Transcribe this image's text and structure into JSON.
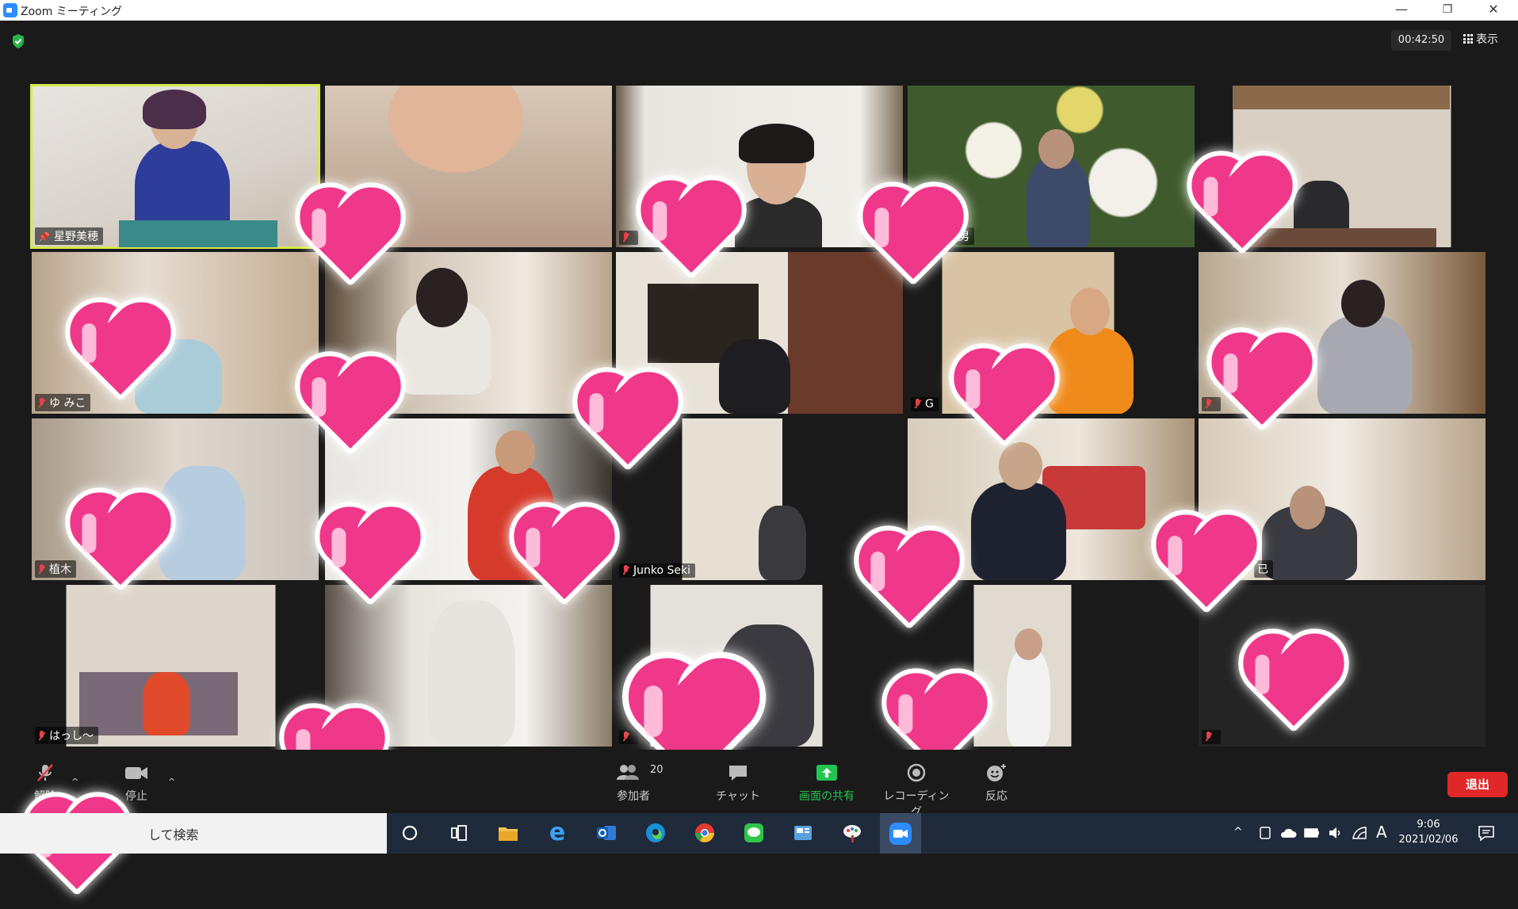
{
  "window": {
    "title": "Zoom ミーティング",
    "minimize": "—",
    "restore": "❐",
    "close": "✕"
  },
  "meeting": {
    "timer": "00:42:50",
    "view_label": "表示",
    "security_color": "#2bb24c",
    "active_border_color": "#d6e94b"
  },
  "participants": [
    {
      "name": "星野美穂",
      "muted": false,
      "pinned": true
    },
    {
      "name": "",
      "muted": false
    },
    {
      "name": "",
      "muted": true
    },
    {
      "name": "男",
      "muted": false
    },
    {
      "name": "",
      "muted": false
    },
    {
      "name": "ゆ みこ",
      "muted": true
    },
    {
      "name": "",
      "muted": false
    },
    {
      "name": "",
      "muted": false
    },
    {
      "name": "G",
      "muted": true
    },
    {
      "name": "",
      "muted": true
    },
    {
      "name": "植木",
      "muted": true
    },
    {
      "name": "",
      "muted": false
    },
    {
      "name": "Junko Seki",
      "muted": true
    },
    {
      "name": "",
      "muted": false
    },
    {
      "name": "已",
      "muted": false
    },
    {
      "name": "はっし〜",
      "muted": true
    },
    {
      "name": "",
      "muted": false
    },
    {
      "name": "",
      "muted": true
    },
    {
      "name": "",
      "muted": false
    },
    {
      "name": "",
      "muted": true
    }
  ],
  "toolbar": {
    "mute_label": "解除",
    "video_label": "停止",
    "participants_label": "参加者",
    "participants_count": "20",
    "chat_label": "チャット",
    "share_label": "画面の共有",
    "record_label": "レコーディング",
    "reactions_label": "反応",
    "leave_label": "退出",
    "share_color": "#23c552",
    "leave_color": "#e02828"
  },
  "taskbar": {
    "search_text": "して検索",
    "time": "9:06",
    "date": "2021/02/06",
    "ime": "A"
  },
  "overlay": {
    "heart_color": "#f0388a"
  }
}
